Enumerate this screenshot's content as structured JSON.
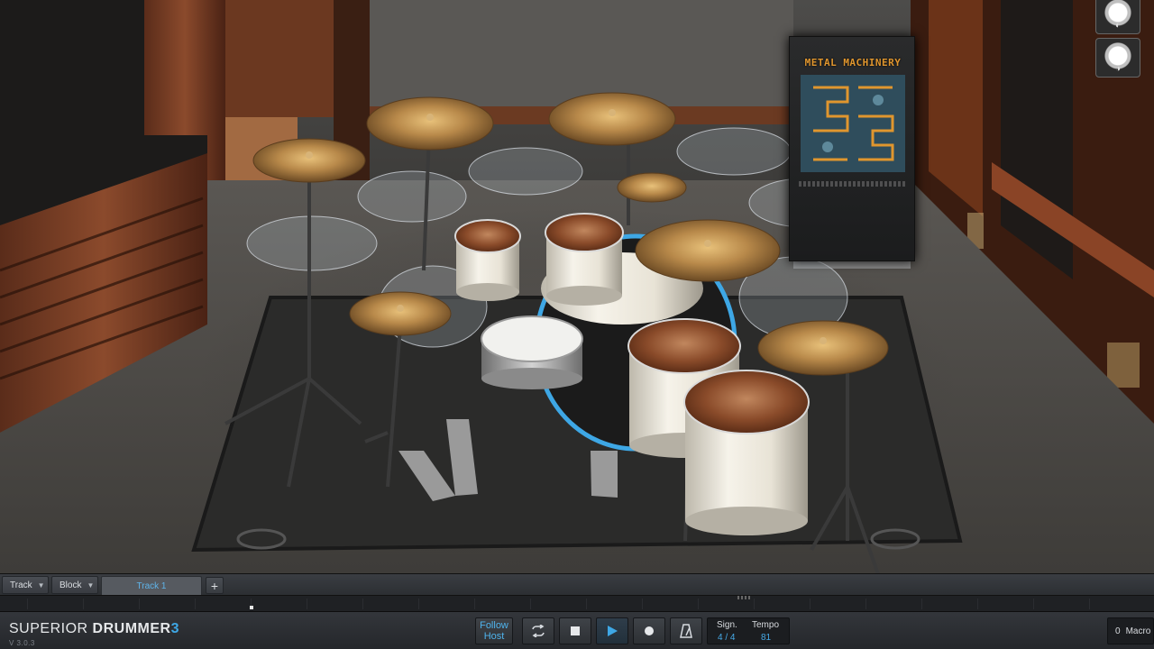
{
  "kit": {
    "banner_title": "METAL MACHINERY",
    "view_buttons": [
      {
        "id": "camera-view-1",
        "icon": "drum-snare-icon"
      },
      {
        "id": "camera-view-2",
        "icon": "drum-tom-icon"
      }
    ]
  },
  "trackbar": {
    "track_menu": "Track",
    "block_menu": "Block",
    "active_tab": "Track 1",
    "add_label": "+"
  },
  "transport": {
    "brand_part1": "SUPERIOR",
    "brand_part2": "DRUMMER",
    "brand_number": "3",
    "version": "V 3.0.3",
    "follow_line1": "Follow",
    "follow_line2": "Host",
    "signature_label": "Sign.",
    "signature_value": "4 / 4",
    "tempo_label": "Tempo",
    "tempo_value": "81",
    "macro_count": "0",
    "macro_label": "Macro"
  },
  "colors": {
    "accent": "#3ea7e5",
    "cymbal": "#b8894a",
    "drum_shell": "#f1ede2",
    "drum_head": "#8a4b2a"
  }
}
